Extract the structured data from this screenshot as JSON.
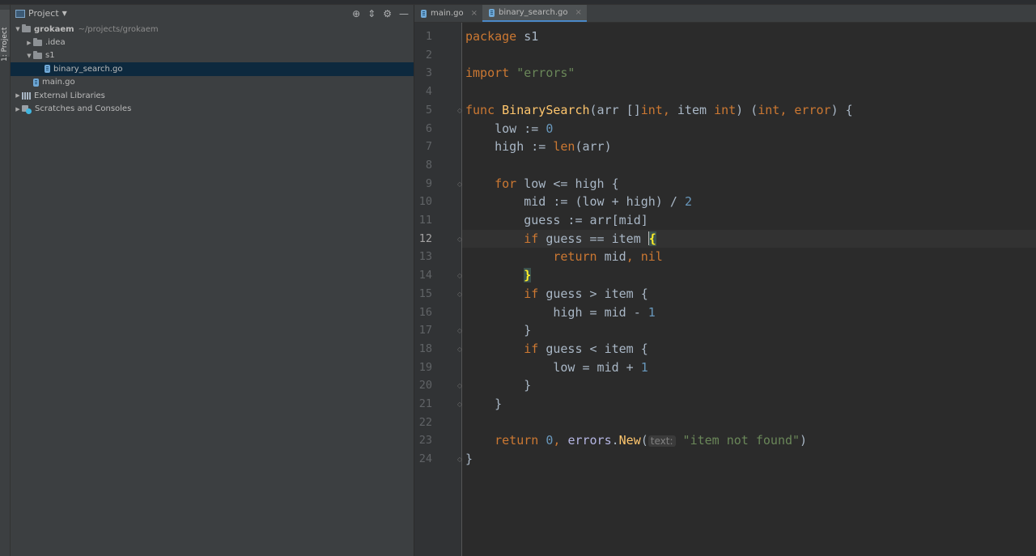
{
  "toolstrip": {
    "project_tab": "1: Project"
  },
  "project_panel": {
    "title": "Project",
    "tree": [
      {
        "label": "grokaem",
        "path": "~/projects/grokaem",
        "kind": "folder",
        "depth": 0,
        "expanded": true
      },
      {
        "label": ".idea",
        "kind": "folder",
        "depth": 1,
        "expanded": false
      },
      {
        "label": "s1",
        "kind": "folder",
        "depth": 1,
        "expanded": true
      },
      {
        "label": "binary_search.go",
        "kind": "gofile",
        "depth": 2,
        "selected": true
      },
      {
        "label": "main.go",
        "kind": "gofile",
        "depth": 1
      },
      {
        "label": "External Libraries",
        "kind": "library",
        "depth": 0,
        "expanded": false
      },
      {
        "label": "Scratches and Consoles",
        "kind": "scratch",
        "depth": 0,
        "expanded": false
      }
    ]
  },
  "editor": {
    "tabs": [
      {
        "label": "main.go",
        "active": false
      },
      {
        "label": "binary_search.go",
        "active": true
      }
    ],
    "current_line": 12,
    "lines": [
      "package s1",
      "",
      "import \"errors\"",
      "",
      "func BinarySearch(arr []int, item int) (int, error) {",
      "    low := 0",
      "    high := len(arr)",
      "",
      "    for low <= high {",
      "        mid := (low + high) / 2",
      "        guess := arr[mid]",
      "        if guess == item {",
      "            return mid, nil",
      "        }",
      "        if guess > item {",
      "            high = mid - 1",
      "        }",
      "        if guess < item {",
      "            low = mid + 1",
      "        }",
      "    }",
      "",
      "    return 0, errors.New(text: \"item not found\")",
      "}"
    ],
    "param_hint": "text:"
  },
  "colors": {
    "keyword": "#cc7832",
    "string": "#6a8759",
    "number": "#6897bb",
    "function_decl": "#ffc66d",
    "selection": "#0d293e",
    "active_tab_underline": "#4a88c7"
  }
}
